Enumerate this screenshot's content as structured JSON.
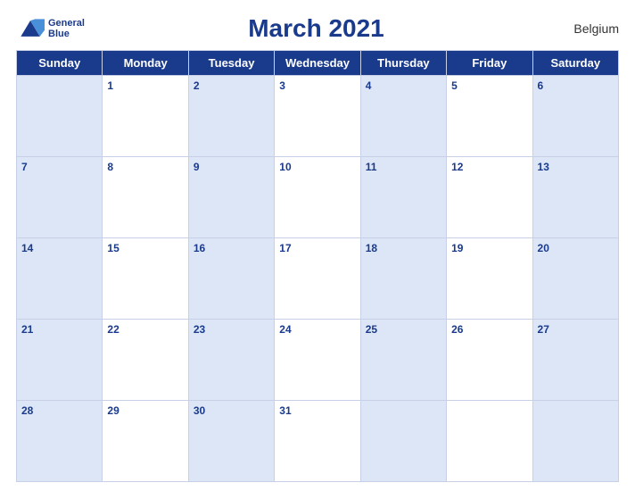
{
  "header": {
    "title": "March 2021",
    "country": "Belgium",
    "logo_line1": "General",
    "logo_line2": "Blue"
  },
  "days_of_week": [
    "Sunday",
    "Monday",
    "Tuesday",
    "Wednesday",
    "Thursday",
    "Friday",
    "Saturday"
  ],
  "weeks": [
    [
      {
        "num": "",
        "bg": "blue"
      },
      {
        "num": "1",
        "bg": "white"
      },
      {
        "num": "2",
        "bg": "blue"
      },
      {
        "num": "3",
        "bg": "white"
      },
      {
        "num": "4",
        "bg": "blue"
      },
      {
        "num": "5",
        "bg": "white"
      },
      {
        "num": "6",
        "bg": "blue"
      }
    ],
    [
      {
        "num": "7",
        "bg": "blue"
      },
      {
        "num": "8",
        "bg": "white"
      },
      {
        "num": "9",
        "bg": "blue"
      },
      {
        "num": "10",
        "bg": "white"
      },
      {
        "num": "11",
        "bg": "blue"
      },
      {
        "num": "12",
        "bg": "white"
      },
      {
        "num": "13",
        "bg": "blue"
      }
    ],
    [
      {
        "num": "14",
        "bg": "blue"
      },
      {
        "num": "15",
        "bg": "white"
      },
      {
        "num": "16",
        "bg": "blue"
      },
      {
        "num": "17",
        "bg": "white"
      },
      {
        "num": "18",
        "bg": "blue"
      },
      {
        "num": "19",
        "bg": "white"
      },
      {
        "num": "20",
        "bg": "blue"
      }
    ],
    [
      {
        "num": "21",
        "bg": "blue"
      },
      {
        "num": "22",
        "bg": "white"
      },
      {
        "num": "23",
        "bg": "blue"
      },
      {
        "num": "24",
        "bg": "white"
      },
      {
        "num": "25",
        "bg": "blue"
      },
      {
        "num": "26",
        "bg": "white"
      },
      {
        "num": "27",
        "bg": "blue"
      }
    ],
    [
      {
        "num": "28",
        "bg": "blue"
      },
      {
        "num": "29",
        "bg": "white"
      },
      {
        "num": "30",
        "bg": "blue"
      },
      {
        "num": "31",
        "bg": "white"
      },
      {
        "num": "",
        "bg": "blue"
      },
      {
        "num": "",
        "bg": "white"
      },
      {
        "num": "",
        "bg": "blue"
      }
    ]
  ]
}
